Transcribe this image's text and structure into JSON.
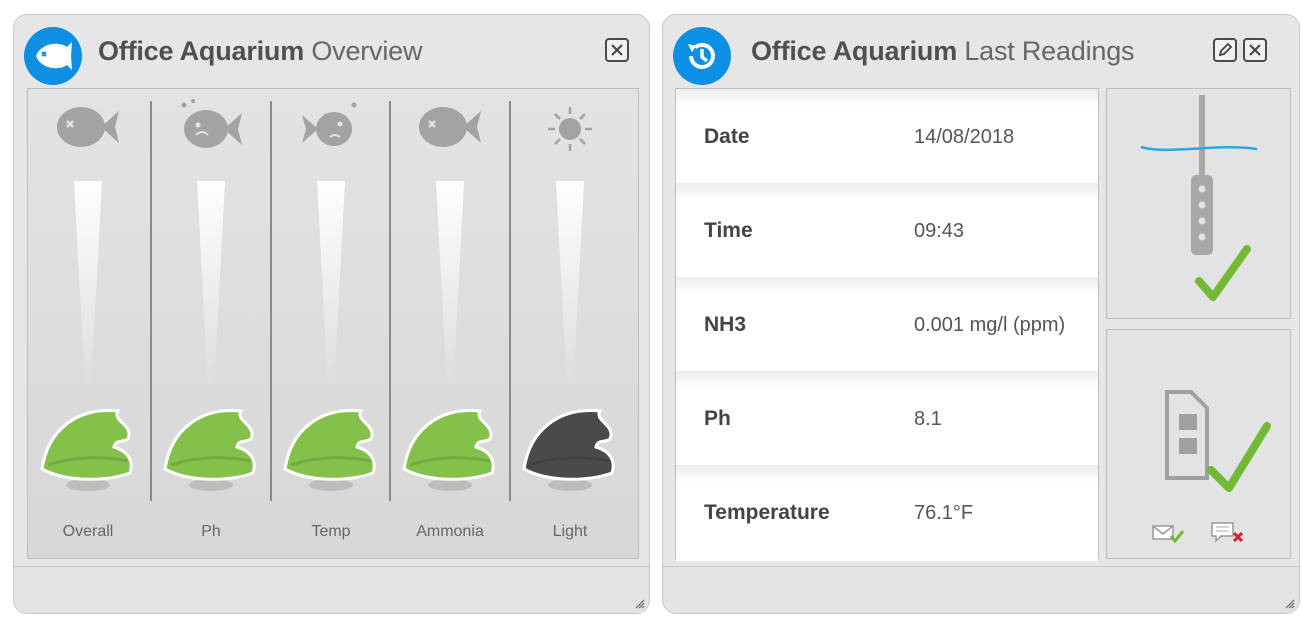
{
  "overview": {
    "title_bold": "Office Aquarium",
    "title_sub": "Overview",
    "columns": [
      {
        "label": "Overall",
        "status_icon": "dead-fish-icon",
        "fish_color": "#84c14a"
      },
      {
        "label": "Ph",
        "status_icon": "sad-fish-icon",
        "fish_color": "#84c14a"
      },
      {
        "label": "Temp",
        "status_icon": "sweating-fish-icon",
        "fish_color": "#84c14a"
      },
      {
        "label": "Ammonia",
        "status_icon": "dead-fish-icon",
        "fish_color": "#84c14a"
      },
      {
        "label": "Light",
        "status_icon": "sun-icon",
        "fish_color": "#4a4a4a"
      }
    ]
  },
  "readings": {
    "title_bold": "Office Aquarium",
    "title_sub": "Last Readings",
    "rows": [
      {
        "key": "Date",
        "value": "14/08/2018"
      },
      {
        "key": "Time",
        "value": "09:43"
      },
      {
        "key": "NH3",
        "value": "0.001 mg/l (ppm)"
      },
      {
        "key": "Ph",
        "value": "8.1"
      },
      {
        "key": "Temperature",
        "value": "76.1°F"
      }
    ],
    "probe_status": "ok",
    "sim_status": "ok",
    "email_status": "ok",
    "sms_status": "error"
  },
  "colors": {
    "accent": "#0d8fe3",
    "ok_green": "#84c14a",
    "error_red": "#d42020"
  }
}
